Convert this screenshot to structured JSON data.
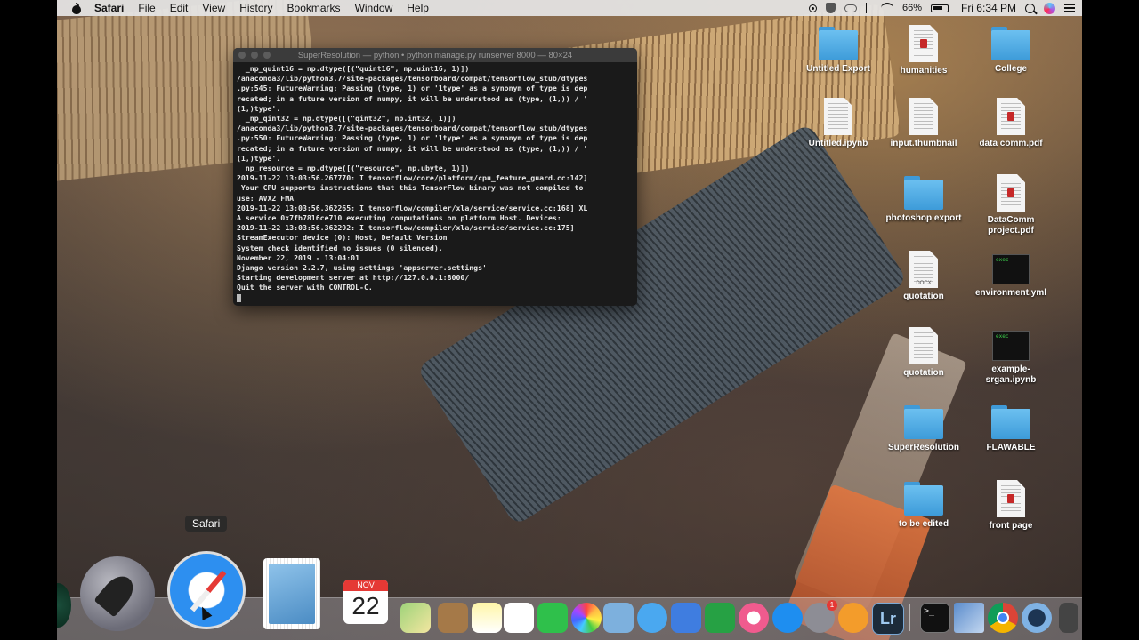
{
  "menubar": {
    "app_name": "Safari",
    "items": [
      "File",
      "Edit",
      "View",
      "History",
      "Bookmarks",
      "Window",
      "Help"
    ],
    "battery": "66%",
    "clock": "Fri 6:34 PM"
  },
  "terminal": {
    "title": "SuperResolution — python • python manage.py runserver 8000 — 80×24",
    "lines": [
      "  _np_quint16 = np.dtype([(\"quint16\", np.uint16, 1)])",
      "/anaconda3/lib/python3.7/site-packages/tensorboard/compat/tensorflow_stub/dtypes",
      ".py:545: FutureWarning: Passing (type, 1) or '1type' as a synonym of type is dep",
      "recated; in a future version of numpy, it will be understood as (type, (1,)) / '",
      "(1,)type'.",
      "  _np_qint32 = np.dtype([(\"qint32\", np.int32, 1)])",
      "/anaconda3/lib/python3.7/site-packages/tensorboard/compat/tensorflow_stub/dtypes",
      ".py:550: FutureWarning: Passing (type, 1) or '1type' as a synonym of type is dep",
      "recated; in a future version of numpy, it will be understood as (type, (1,)) / '",
      "(1,)type'.",
      "  np_resource = np.dtype([(\"resource\", np.ubyte, 1)])",
      "2019-11-22 13:03:56.267770: I tensorflow/core/platform/cpu_feature_guard.cc:142]",
      " Your CPU supports instructions that this TensorFlow binary was not compiled to",
      "use: AVX2 FMA",
      "2019-11-22 13:03:56.362265: I tensorflow/compiler/xla/service/service.cc:168] XL",
      "A service 0x7fb7816ce710 executing computations on platform Host. Devices:",
      "2019-11-22 13:03:56.362292: I tensorflow/compiler/xla/service/service.cc:175]",
      "StreamExecutor device (0): Host, Default Version",
      "System check identified no issues (0 silenced).",
      "November 22, 2019 - 13:04:01",
      "Django version 2.2.7, using settings 'appserver.settings'",
      "Starting development server at http://127.0.0.1:8000/",
      "Quit the server with CONTROL-C."
    ]
  },
  "desktop": {
    "icons": [
      {
        "label": "Untitled Export",
        "kind": "folder"
      },
      {
        "label": "humanities",
        "kind": "pdf"
      },
      {
        "label": "College",
        "kind": "folder"
      },
      {
        "label": "Untitled.ipynb",
        "kind": "doc"
      },
      {
        "label": "input.thumbnail",
        "kind": "doc"
      },
      {
        "label": "data comm.pdf",
        "kind": "pdf"
      },
      {
        "label": "photoshop export",
        "kind": "folder"
      },
      {
        "label": "DataComm project.pdf",
        "kind": "pdf"
      },
      {
        "label": "quotation",
        "kind": "docx"
      },
      {
        "label": "environment.yml",
        "kind": "exec"
      },
      {
        "label": "quotation",
        "kind": "doc"
      },
      {
        "label": "example-srgan.ipynb",
        "kind": "exec"
      },
      {
        "label": "SuperResolution",
        "kind": "folder"
      },
      {
        "label": "FLAWABLE",
        "kind": "folder"
      },
      {
        "label": "to be edited",
        "kind": "folder"
      },
      {
        "label": "front page",
        "kind": "pdf"
      }
    ],
    "exec_badge": "exec",
    "docx_badge": "DOCX"
  },
  "dock": {
    "tooltip": "Safari",
    "calendar_month": "NOV",
    "calendar_day": "22",
    "lightroom_label": "Lr",
    "terminal_glyph": ">_",
    "prefs_badge": "1"
  }
}
